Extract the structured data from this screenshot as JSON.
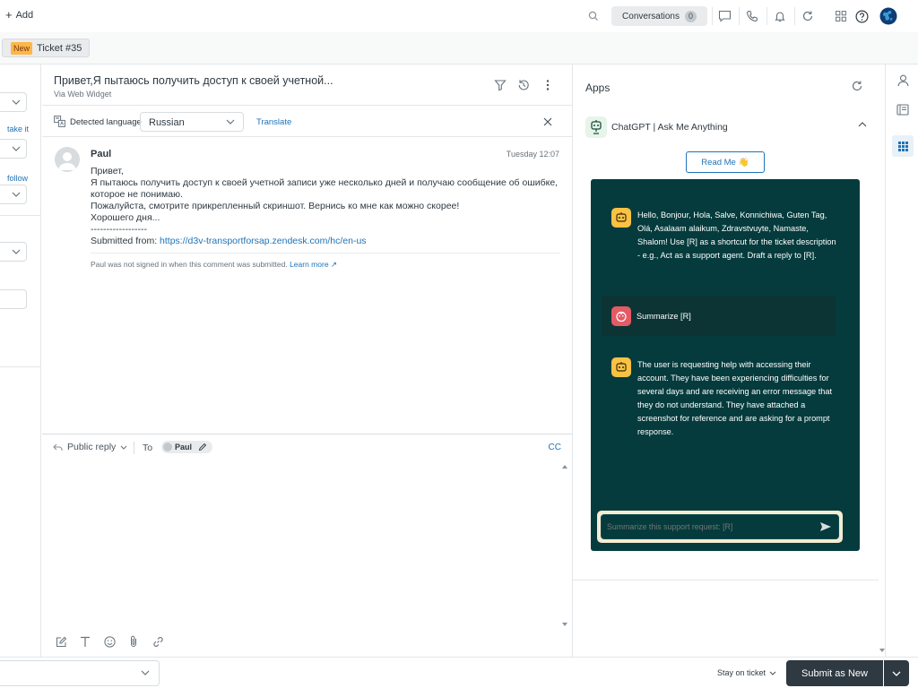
{
  "topbar": {
    "add_label": "Add",
    "conversations_label": "Conversations",
    "conversations_count": "0"
  },
  "tabs": {
    "badge": "New",
    "label": "Ticket #35"
  },
  "left_panel": {
    "link_1": "take it",
    "link_2": "follow"
  },
  "ticket": {
    "title": "Привет,Я пытаюсь получить доступ к своей учетной...",
    "via": "Via Web Widget",
    "detected_language_label": "Detected language",
    "language": "Russian",
    "translate_label": "Translate"
  },
  "message": {
    "author": "Paul",
    "time": "Tuesday 12:07",
    "lines": [
      "Привет,",
      "Я пытаюсь получить доступ к своей учетной записи уже несколько дней и получаю сообщение об ошибке,",
      "которое не понимаю.",
      "Пожалуйста, смотрите прикрепленный скриншот. Вернись ко мне как можно скорее!",
      "Хорошего дня...",
      "------------------"
    ],
    "submitted_from_label": "Submitted from: ",
    "submitted_url": "https://d3v-transportforsap.zendesk.com/hc/en-us",
    "note": "Paul was not signed in when this comment was submitted.",
    "learn_more": "Learn more"
  },
  "reply": {
    "type_label": "Public reply",
    "to_label": "To",
    "recipient": "Paul",
    "cc_label": "CC"
  },
  "apps": {
    "title": "Apps",
    "app_name": "ChatGPT | Ask Me Anything",
    "readme_label": "Read Me",
    "readme_emoji": "👋",
    "chat": [
      {
        "role": "bot",
        "text": "Hello, Bonjour, Hola, Salve, Konnichiwa, Guten Tag, Olá, Asalaam alaikum, Zdravstvuyte, Namaste, Shalom! Use [R] as a shortcut for the ticket description - e.g., Act as a support agent. Draft a reply to [R]."
      },
      {
        "role": "user",
        "text": "Summarize [R]"
      },
      {
        "role": "bot",
        "text": "The user is requesting help with accessing their account. They have been experiencing difficulties for several days and are receiving an error message that they do not understand. They have attached a screenshot for reference and are asking for a prompt response."
      }
    ],
    "input_placeholder": "Summarize this support request: [R]"
  },
  "footer": {
    "stay_on_label": "Stay on ticket",
    "submit_label": "Submit as New"
  },
  "colors": {
    "chat_background": "#053b3d",
    "bot_avatar": "#f8c244",
    "user_avatar": "#e35b66",
    "new_badge": "#ffb648",
    "primary_button": "#2f3941",
    "link": "#1f73b7"
  },
  "icons": [
    "plus-icon",
    "search-icon",
    "chat-icon",
    "phone-icon",
    "bell-icon",
    "refresh-icon",
    "apps-grid-icon",
    "help-icon",
    "globe-icon",
    "filter-icon",
    "history-icon",
    "more-icon",
    "translate-icon",
    "close-icon",
    "reply-icon",
    "edit-icon",
    "compose-icon",
    "text-format-icon",
    "emoji-icon",
    "attach-icon",
    "link-icon",
    "send-icon",
    "user-icon",
    "book-icon"
  ]
}
